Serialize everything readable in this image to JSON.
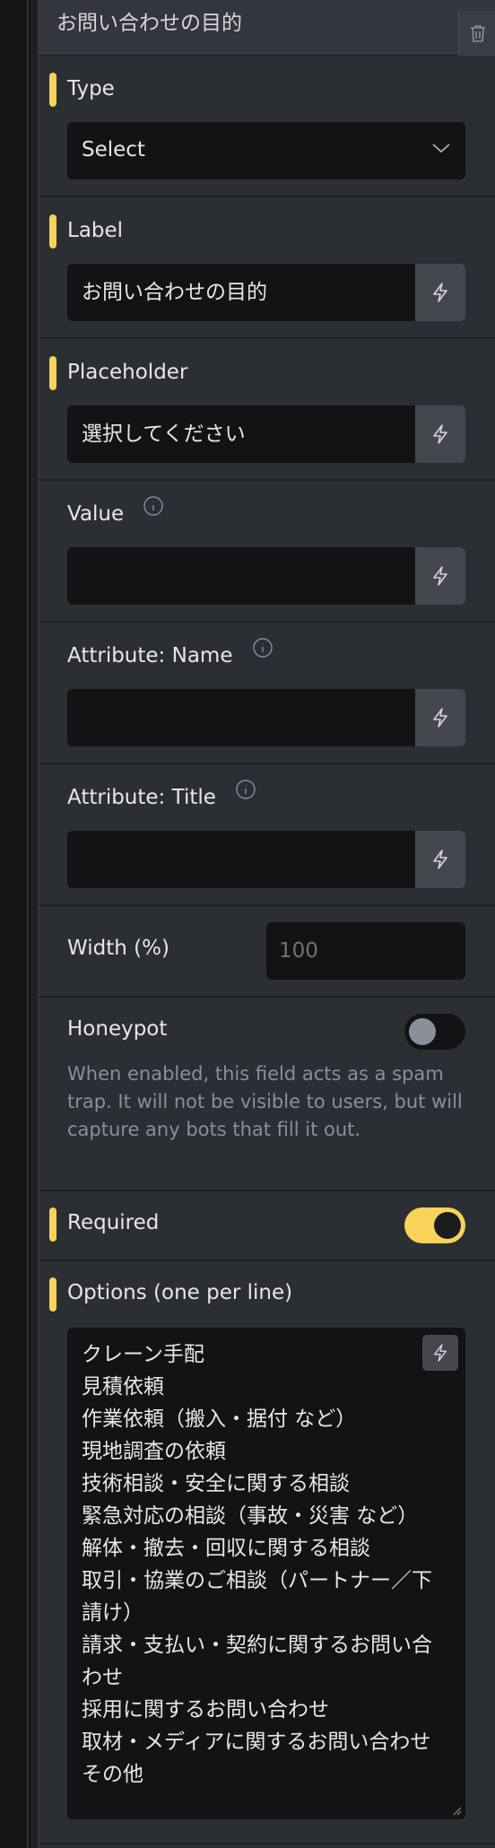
{
  "header": {
    "title": "お問い合わせの目的"
  },
  "type": {
    "label": "Type",
    "value": "Select"
  },
  "label_field": {
    "label": "Label",
    "value": "お問い合わせの目的"
  },
  "placeholder_field": {
    "label": "Placeholder",
    "value": "選択してください"
  },
  "value_field": {
    "label": "Value",
    "value": ""
  },
  "attr_name": {
    "label": "Attribute: Name",
    "value": ""
  },
  "attr_title": {
    "label": "Attribute: Title",
    "value": ""
  },
  "width": {
    "label": "Width (%)",
    "placeholder": "100"
  },
  "honeypot": {
    "label": "Honeypot",
    "enabled": false,
    "description": "When enabled, this field acts as a spam trap. It will not be visible to users, but will capture any bots that fill it out."
  },
  "required": {
    "label": "Required",
    "enabled": true
  },
  "options": {
    "label": "Options (one per line)",
    "lines": [
      "クレーン手配",
      "見積依頼",
      "作業依頼（搬入・据付 など）",
      "現地調査の依頼",
      "技術相談・安全に関する相談",
      "緊急対応の相談（事故・災害 など）",
      "解体・撤去・回収に関する相談",
      "取引・協業のご相談（パートナー／下",
      "請け）",
      "請求・支払い・契約に関するお問い合",
      "わせ",
      "採用に関するお問い合わせ",
      "取材・メディアに関するお問い合わせ",
      "その他"
    ]
  },
  "colors": {
    "accent": "#f7d35a",
    "panel": "#2b2e33",
    "input": "#121315",
    "button": "#44474e"
  },
  "icons": {
    "trash": "trash-icon",
    "bolt": "bolt-icon",
    "chevron": "chevron-down-icon",
    "info": "info-icon",
    "resize": "resize-handle-icon"
  }
}
